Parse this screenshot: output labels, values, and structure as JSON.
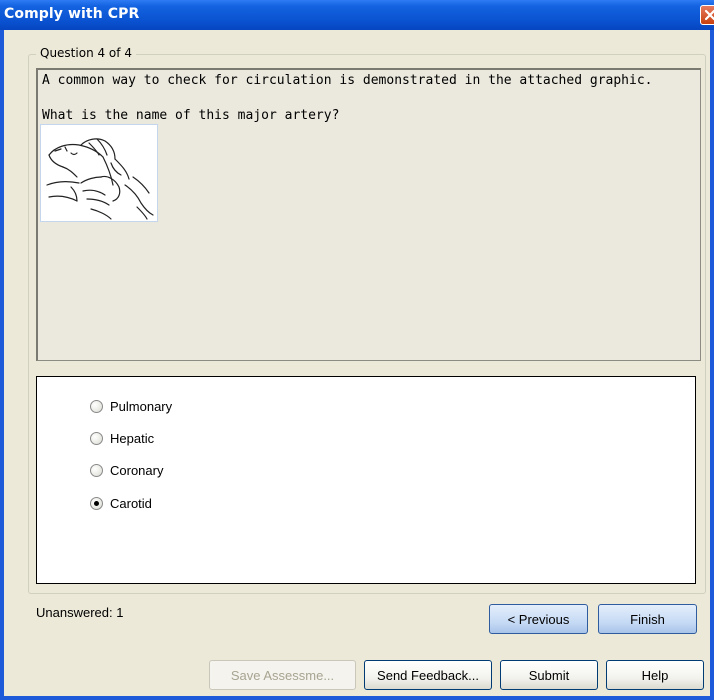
{
  "window": {
    "title": "Comply with CPR"
  },
  "question": {
    "counter": "Question 4 of 4",
    "line1": "A common way to check for circulation is demonstrated in the attached graphic.",
    "line2": "What is the name of this major artery?"
  },
  "answers": {
    "options": [
      {
        "label": "Pulmonary",
        "selected": false
      },
      {
        "label": "Hepatic",
        "selected": false
      },
      {
        "label": "Coronary",
        "selected": false
      },
      {
        "label": "Carotid",
        "selected": true
      }
    ]
  },
  "status": {
    "unanswered": "Unanswered: 1"
  },
  "nav": {
    "previous": "< Previous",
    "finish": "Finish"
  },
  "footer": {
    "save": "Save Assessme...",
    "feedback": "Send Feedback...",
    "submit": "Submit",
    "help": "Help"
  },
  "colors": {
    "titlebar": "#0A52D1",
    "frame": "#ECE9D8",
    "close": "#C8400E"
  },
  "icons": {
    "close": "close-icon",
    "image": "cpr-pulse-check-illustration"
  }
}
